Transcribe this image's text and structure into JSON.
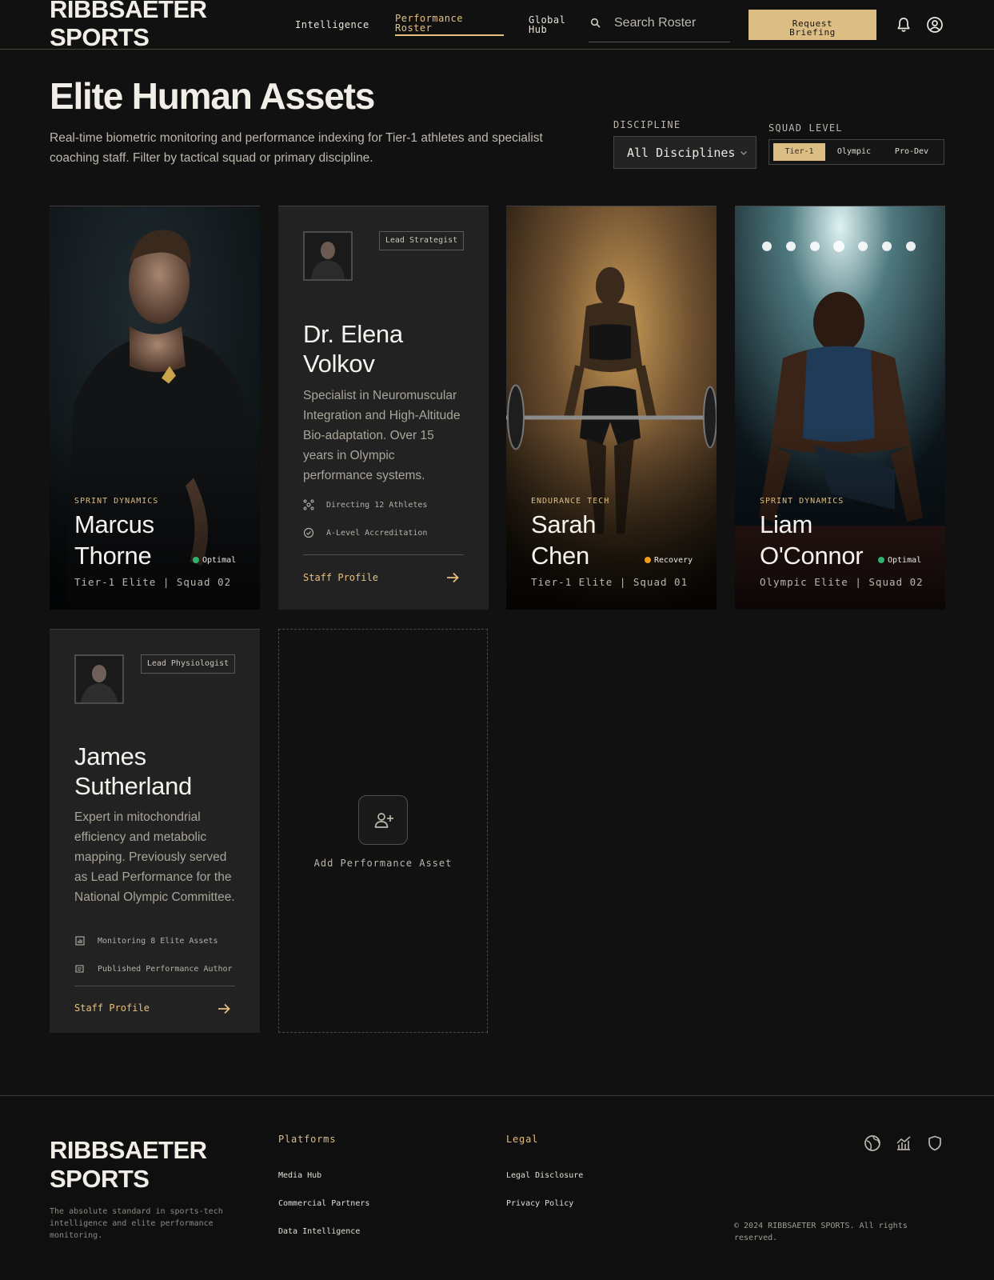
{
  "brand": {
    "name": "RIBBSAETER SPORTS",
    "line1": "RIBBSAETER",
    "line2": "SPORTS",
    "accent": "#dcbd84"
  },
  "nav": {
    "items": [
      {
        "line1": "Intelligence",
        "line2": ""
      },
      {
        "line1": "Performance",
        "line2": "Roster",
        "active": true
      },
      {
        "line1": "Global",
        "line2": "Hub"
      }
    ]
  },
  "search": {
    "placeholder": "Search Roster",
    "icon": "search-icon"
  },
  "header": {
    "cta_line1": "Request",
    "cta_line2": "Briefing",
    "icons": [
      "bell-icon",
      "user-circle-icon"
    ]
  },
  "hero": {
    "title": "Elite Human Assets",
    "lead": "Real-time biometric monitoring and performance indexing for Tier-1 athletes and specialist coaching staff. Filter by tactical squad or primary discipline."
  },
  "filters": {
    "discipline_label": "DISCIPLINE",
    "discipline_value": "All Disciplines",
    "squad_label": "SQUAD LEVEL",
    "squad_options": [
      "Tier-1",
      "Olympic",
      "Pro-Dev"
    ],
    "squad_selected": "Tier-1"
  },
  "athletes": [
    {
      "category": "SPRINT DYNAMICS",
      "first": "Marcus",
      "last": "Thorne",
      "status": "Optimal",
      "status_color": "#2db36f",
      "meta": "Tier-1 Elite | Squad 02"
    },
    {
      "category": "ENDURANCE TECH",
      "first": "Sarah",
      "last": "Chen",
      "status": "Recovery",
      "status_color": "#f39c1a",
      "meta": "Tier-1 Elite | Squad 01"
    },
    {
      "category": "SPRINT DYNAMICS",
      "first": "Liam",
      "last": "O'Connor",
      "status": "Optimal",
      "status_color": "#2db36f",
      "meta": "Olympic Elite | Squad 02"
    }
  ],
  "staff": [
    {
      "role": "Lead Strategist",
      "first": "Dr. Elena",
      "last": "Volkov",
      "desc": "Specialist in Neuromuscular Integration and High-Altitude Bio-adaptation. Over 15 years in Olympic performance systems.",
      "stat1": "Directing 12 Athletes",
      "stat1_icon": "network-icon",
      "stat2": "A-Level Accreditation",
      "stat2_icon": "verified-badge-icon",
      "link": "Staff Profile"
    },
    {
      "role": "Lead Physiologist",
      "first": "James",
      "last": "Sutherland",
      "desc": "Expert in mitochondrial efficiency and metabolic mapping. Previously served as Lead Performance for the National Olympic Committee.",
      "stat1": "Monitoring 8 Elite Assets",
      "stat1_icon": "chart-icon",
      "stat2": "Published Performance Author",
      "stat2_icon": "document-icon",
      "link": "Staff Profile"
    }
  ],
  "add_card": {
    "label": "Add Performance Asset",
    "icon": "user-plus-icon"
  },
  "footer": {
    "tagline": "The absolute standard in sports-tech intelligence and elite performance monitoring.",
    "platforms_heading": "Platforms",
    "platforms": [
      "Media Hub",
      "Commercial Partners",
      "Data Intelligence"
    ],
    "legal_heading": "Legal",
    "legal": [
      "Legal Disclosure",
      "Privacy Policy"
    ],
    "icons": [
      "globe-icon",
      "analytics-icon",
      "shield-icon"
    ],
    "copyright": "© 2024 RIBBSAETER SPORTS. All rights reserved."
  }
}
